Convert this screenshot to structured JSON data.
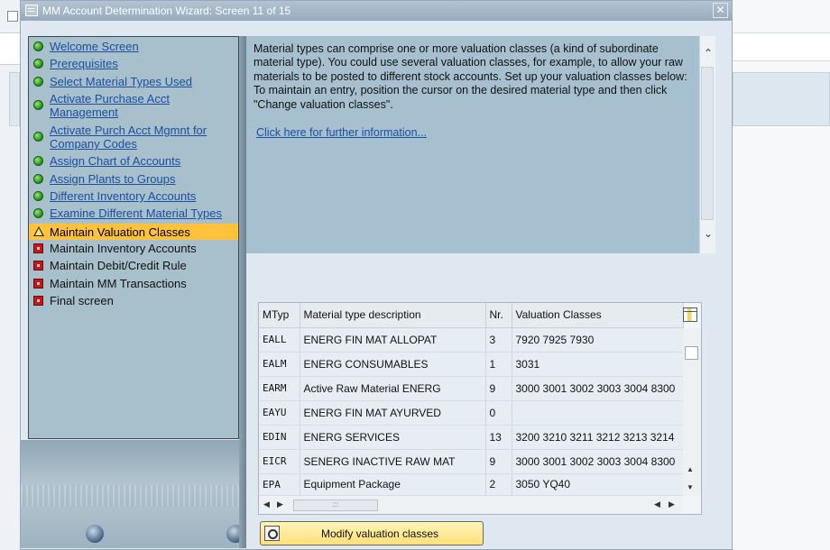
{
  "window": {
    "title": "MM Account Determination Wizard: Screen 11 of 15",
    "close_label": "✕"
  },
  "steps": [
    {
      "label": "Welcome Screen",
      "status": "done"
    },
    {
      "label": "Prerequisites",
      "status": "done"
    },
    {
      "label": "Select Material Types Used",
      "status": "done"
    },
    {
      "label": "Activate Purchase Acct Management",
      "status": "done"
    },
    {
      "label": "Activate Purch Acct Mgmnt for Company Codes",
      "status": "done"
    },
    {
      "label": "Assign Chart of Accounts",
      "status": "done"
    },
    {
      "label": "Assign Plants to Groups",
      "status": "done"
    },
    {
      "label": "Different Inventory Accounts",
      "status": "done"
    },
    {
      "label": "Examine Different Material Types",
      "status": "done"
    },
    {
      "label": "Maintain Valuation Classes",
      "status": "current"
    },
    {
      "label": "Maintain Inventory Accounts",
      "status": "pending"
    },
    {
      "label": "Maintain Debit/Credit Rule",
      "status": "pending"
    },
    {
      "label": "Maintain MM Transactions",
      "status": "pending"
    },
    {
      "label": "Final screen",
      "status": "pending"
    }
  ],
  "info": {
    "text": "Material types can comprise one or more valuation classes (a kind of subordinate material type). You could use several valuation classes, for example, to allow your raw materials to be posted to different stock accounts. Set up your valuation classes below: To maintain an entry, position the cursor on the desired material type and then click \"Change valuation classes\".",
    "link": "Click here for further information..."
  },
  "table": {
    "headers": [
      "MTyp",
      "Material type description",
      "Nr.",
      "Valuation Classes"
    ],
    "rows": [
      [
        "EALL",
        "ENERG FIN MAT ALLOPAT",
        "3",
        "7920 7925 7930"
      ],
      [
        "EALM",
        "ENERG CONSUMABLES",
        "1",
        "3031"
      ],
      [
        "EARM",
        "Active Raw Material ENERG",
        "9",
        "3000 3001 3002 3003 3004 8300"
      ],
      [
        "EAYU",
        "ENERG FIN MAT AYURVED",
        "0",
        ""
      ],
      [
        "EDIN",
        "ENERG SERVICES",
        "13",
        "3200 3210 3211 3212 3213 3214"
      ],
      [
        "EICR",
        "SENERG INACTIVE RAW MAT",
        "9",
        "3000 3001 3002 3003 3004 8300"
      ],
      [
        "EPA",
        "Equipment Package",
        "2",
        "3050 YQ40"
      ]
    ]
  },
  "buttons": {
    "modify": "Modify valuation classes"
  },
  "colors": {
    "accent_current_step": "#ffc23a",
    "link": "#1c4fa0",
    "done": "#1f8a1f",
    "pending": "#c51717"
  }
}
